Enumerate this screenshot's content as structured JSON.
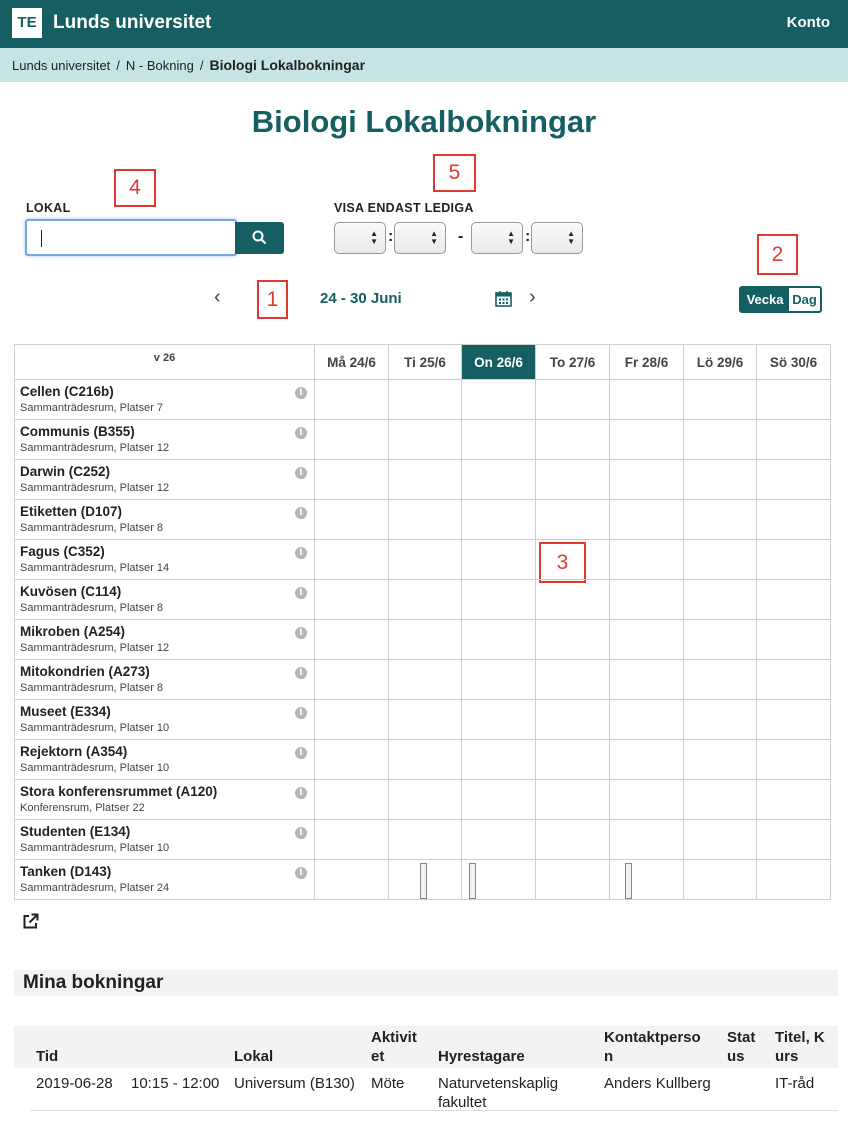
{
  "header": {
    "logo": "TE",
    "app_name": "Lunds universitet",
    "account": "Konto"
  },
  "breadcrumb": {
    "items": [
      "Lunds universitet",
      "N - Bokning"
    ],
    "current": "Biologi Lokalbokningar",
    "separator": "/"
  },
  "page_title": "Biologi Lokalbokningar",
  "annotations": [
    "1",
    "2",
    "3",
    "4",
    "5"
  ],
  "search": {
    "label": "LOKAL",
    "value": ""
  },
  "filter": {
    "label": "VISA ENDAST LEDIGA",
    "dash": "-",
    "colon": ":"
  },
  "navigation": {
    "range": "24 - 30 Juni",
    "prev": "‹",
    "next": "›"
  },
  "view_toggle": {
    "week": "Vecka",
    "day": "Dag",
    "active": "week"
  },
  "grid": {
    "week_label": "v 26",
    "days": [
      "Må 24/6",
      "Ti 25/6",
      "On 26/6",
      "To 27/6",
      "Fr 28/6",
      "Lö 29/6",
      "Sö 30/6"
    ],
    "today_index": 2,
    "rooms": [
      {
        "name": "Cellen (C216b)",
        "sub": "Sammanträdesrum, Platser 7"
      },
      {
        "name": "Communis (B355)",
        "sub": "Sammanträdesrum, Platser 12"
      },
      {
        "name": "Darwin (C252)",
        "sub": "Sammanträdesrum, Platser 12"
      },
      {
        "name": "Etiketten (D107)",
        "sub": "Sammanträdesrum, Platser 8"
      },
      {
        "name": "Fagus (C352)",
        "sub": "Sammanträdesrum, Platser 14"
      },
      {
        "name": "Kuvösen (C114)",
        "sub": "Sammanträdesrum, Platser 8"
      },
      {
        "name": "Mikroben (A254)",
        "sub": "Sammanträdesrum, Platser 12"
      },
      {
        "name": "Mitokondrien (A273)",
        "sub": "Sammanträdesrum, Platser 8"
      },
      {
        "name": "Museet (E334)",
        "sub": "Sammanträdesrum, Platser 10"
      },
      {
        "name": "Rejektorn (A354)",
        "sub": "Sammanträdesrum, Platser 10"
      },
      {
        "name": "Stora konferensrummet (A120)",
        "sub": "Konferensrum, Platser 22"
      },
      {
        "name": "Studenten (E134)",
        "sub": "Sammanträdesrum, Platser 10"
      },
      {
        "name": "Tanken (D143)",
        "sub": "Sammanträdesrum, Platser 24"
      }
    ],
    "info_glyph": "i"
  },
  "my_bookings": {
    "title": "Mina bokningar",
    "headers": [
      "Tid",
      "Lokal",
      "Aktivit",
      "et",
      "Hyrestagare",
      "Kontaktperso",
      "n",
      "Stat",
      "us",
      "Titel, K",
      "urs"
    ],
    "rows": [
      {
        "date": "2019-06-28",
        "time": "10:15 - 12:00",
        "room": "Universum (B130)",
        "activity": "Möte",
        "tenant_1": "Naturvetenskaplig",
        "tenant_2": "fakultet",
        "contact": "Anders Kullberg",
        "status": "",
        "title": "IT-råd"
      }
    ]
  },
  "colors": {
    "brand": "#155f63",
    "breadcrumb_bg": "#c6e4e3",
    "annotation": "#e03a30"
  },
  "icons": [
    "search-icon",
    "calendar-icon",
    "chevron-left-icon",
    "chevron-right-icon",
    "info-icon",
    "external-link-icon"
  ]
}
